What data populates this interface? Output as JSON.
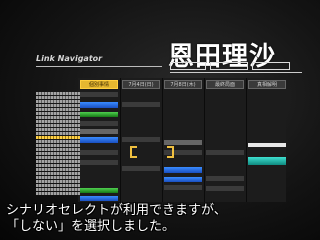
{
  "header": {
    "character_name": "恩田理沙",
    "app_title": "Link Navigator"
  },
  "tabs": [
    {
      "label": "個別事情",
      "active": true
    },
    {
      "label": "7月4日(日)",
      "active": false
    },
    {
      "label": "7月8日(木)",
      "active": false
    },
    {
      "label": "最終局面",
      "active": false
    },
    {
      "label": "真相解明",
      "active": false
    }
  ],
  "colors": {
    "accent": "#e6b830",
    "blue": "#2a6cf0",
    "green": "#2fa82f",
    "teal": "#2fc0b0"
  },
  "subtitle": {
    "line1": "シナリオセレクトが利用できますが、",
    "line2": "「しない」を選択しました。"
  }
}
